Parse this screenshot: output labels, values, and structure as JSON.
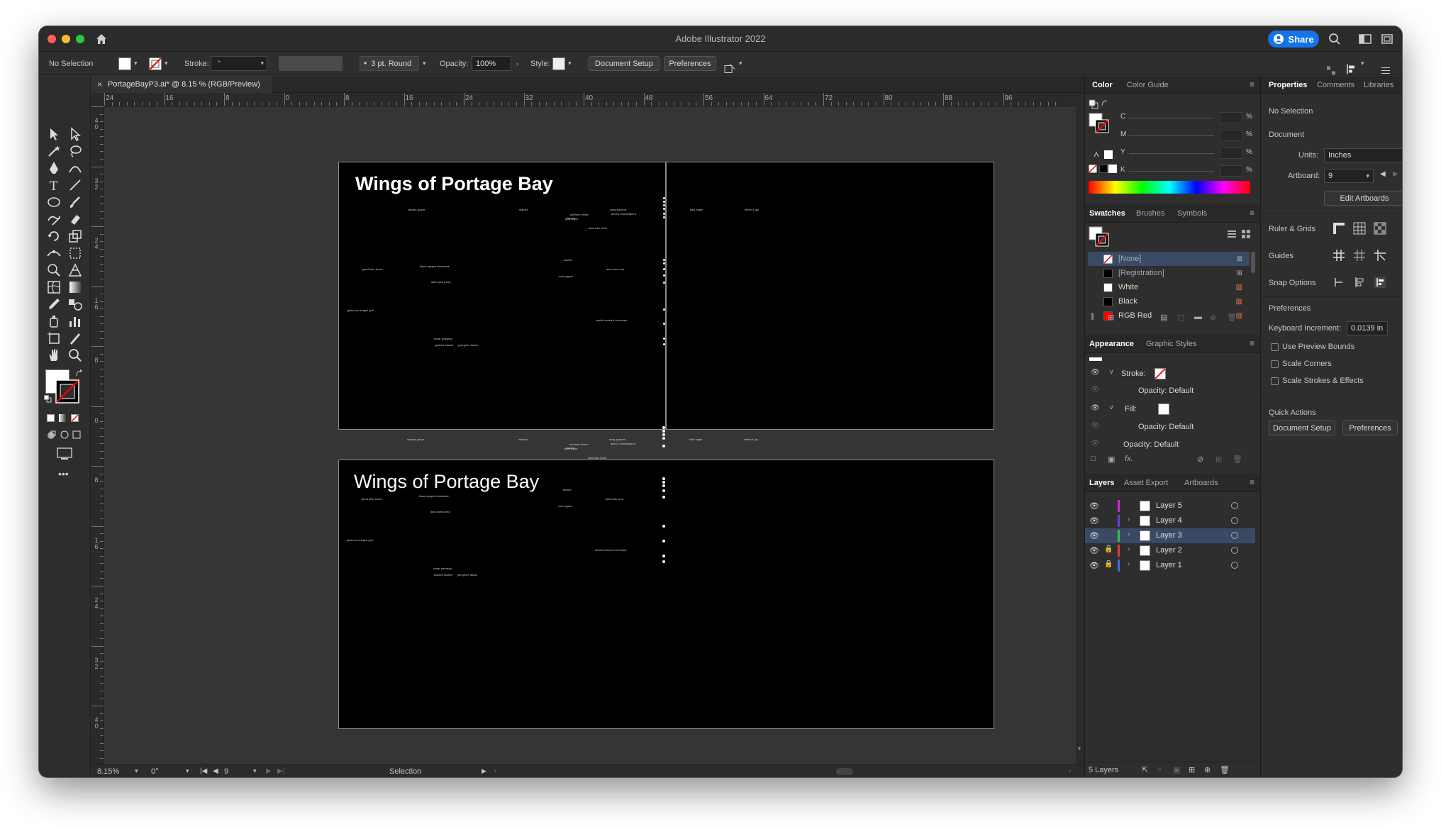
{
  "app": {
    "title": "Adobe Illustrator 2022",
    "share_label": "Share"
  },
  "controlbar": {
    "selection": "No Selection",
    "stroke_label": "Stroke:",
    "brush": "3 pt. Round",
    "opacity_label": "Opacity:",
    "opacity_value": "100%",
    "style_label": "Style:",
    "document_setup": "Document Setup",
    "preferences": "Preferences"
  },
  "document": {
    "tab_title": "PortageBayP3.ai* @ 8.15 % (RGB/Preview)"
  },
  "rulers": {
    "top": [
      "24",
      "16",
      "8",
      "0",
      "8",
      "16",
      "24",
      "32",
      "40",
      "48",
      "56",
      "64",
      "72",
      "80",
      "88",
      "96"
    ],
    "left": [
      [
        "4",
        "0"
      ],
      [
        "3",
        "2"
      ],
      [
        "2",
        "4"
      ],
      [
        "1",
        "6"
      ],
      [
        "8"
      ],
      [
        "0"
      ],
      [
        "8"
      ],
      [
        "1",
        "6"
      ],
      [
        "2",
        "4"
      ],
      [
        "3",
        "2"
      ],
      [
        "4",
        "0"
      ]
    ]
  },
  "artboards": {
    "title": "Wings of Portage Bay",
    "labels": [
      "canada goose",
      "mallard",
      "northern flicker",
      "pine siskin",
      "song sparrow",
      "anna's hummingbird",
      "american robin",
      "bald eagle",
      "steller's jay",
      "great blue heron",
      "black-capped chickadee",
      "bushtit",
      "rock pigeon",
      "american crow",
      "dark-eyed junco",
      "double-crested cormorant",
      "cedar waxwing",
      "spotted towhee",
      "peregrine falcon",
      "glaucous-winged gull",
      "osprey"
    ]
  },
  "statusbar": {
    "zoom": "8.15%",
    "rotation": "0°",
    "artboard": "9",
    "tool": "Selection",
    "layers_count": "5 Layers"
  },
  "color_panel": {
    "tabs": [
      "Color",
      "Color Guide"
    ],
    "channels": [
      "C",
      "M",
      "Y",
      "K"
    ],
    "unit": "%"
  },
  "swatches_panel": {
    "tabs": [
      "Swatches",
      "Brushes",
      "Symbols"
    ],
    "items": [
      {
        "name": "[None]",
        "color": "none"
      },
      {
        "name": "[Registration]",
        "color": "#000000"
      },
      {
        "name": "White",
        "color": "#ffffff"
      },
      {
        "name": "Black",
        "color": "#000000"
      },
      {
        "name": "RGB Red",
        "color": "#ff0000"
      }
    ]
  },
  "appearance_panel": {
    "tabs": [
      "Appearance",
      "Graphic Styles"
    ],
    "stroke_label": "Stroke:",
    "fill_label": "Fill:",
    "opacity_default": "Opacity: Default"
  },
  "layers_panel": {
    "tabs": [
      "Layers",
      "Asset Export",
      "Artboards"
    ],
    "layers": [
      {
        "name": "Layer 5",
        "color": "#c92ccf",
        "locked": false,
        "expandable": false,
        "selected": false
      },
      {
        "name": "Layer 4",
        "color": "#6b3fd6",
        "locked": false,
        "expandable": true,
        "selected": false
      },
      {
        "name": "Layer 3",
        "color": "#3fbf3f",
        "locked": false,
        "expandable": true,
        "selected": true
      },
      {
        "name": "Layer 2",
        "color": "#e03b3b",
        "locked": true,
        "expandable": true,
        "selected": false
      },
      {
        "name": "Layer 1",
        "color": "#3d6fe0",
        "locked": true,
        "expandable": true,
        "selected": false
      }
    ]
  },
  "properties_panel": {
    "tabs": [
      "Properties",
      "Comments",
      "Libraries"
    ],
    "no_selection": "No Selection",
    "document_heading": "Document",
    "units_label": "Units:",
    "units_value": "Inches",
    "artboard_label": "Artboard:",
    "artboard_value": "9",
    "edit_artboards": "Edit Artboards",
    "ruler_grids": "Ruler & Grids",
    "guides": "Guides",
    "snap_options": "Snap Options",
    "preferences_heading": "Preferences",
    "keyboard_increment_label": "Keyboard Increment:",
    "keyboard_increment_value": "0.0139 in",
    "use_preview_bounds": "Use Preview Bounds",
    "scale_corners": "Scale Corners",
    "scale_strokes": "Scale Strokes & Effects",
    "quick_actions": "Quick Actions",
    "document_setup": "Document Setup",
    "preferences_btn": "Preferences"
  },
  "colors": {
    "accent": "#1473e6",
    "artboard_bg": "#000000",
    "canvas_bg": "#353535"
  }
}
